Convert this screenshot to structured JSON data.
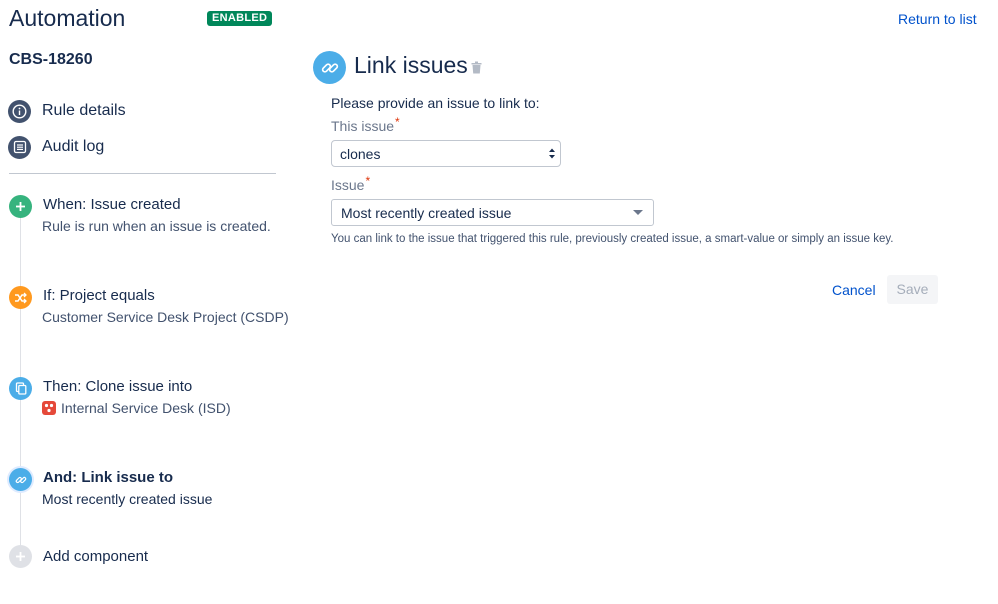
{
  "header": {
    "title": "Automation",
    "status_badge": "ENABLED",
    "return_link": "Return to list"
  },
  "rule": {
    "id": "CBS-18260"
  },
  "nav": {
    "rule_details": "Rule details",
    "audit_log": "Audit log"
  },
  "steps": [
    {
      "title": "When: Issue created",
      "description": "Rule is run when an issue is created.",
      "icon": "plus-icon",
      "color": "#36b37e"
    },
    {
      "title": "If: Project equals",
      "description": "Customer Service Desk Project (CSDP)",
      "icon": "shuffle-icon",
      "color": "#ff991f"
    },
    {
      "title": "Then: Clone issue into",
      "description": "Internal Service Desk (ISD)",
      "icon": "copy-icon",
      "color": "#4bade8"
    },
    {
      "title": "And: Link issue to",
      "description": "Most recently created issue",
      "icon": "link-icon",
      "color": "#4bade8"
    }
  ],
  "add_component": "Add component",
  "panel": {
    "title": "Link issues",
    "instruction": "Please provide an issue to link to:",
    "this_issue_label": "This issue",
    "this_issue_value": "clones",
    "issue_label": "Issue",
    "issue_value": "Most recently created issue",
    "help_text": "You can link to the issue that triggered this rule, previously created issue, a smart-value or simply an issue key.",
    "required_marker": "*"
  },
  "actions": {
    "cancel": "Cancel",
    "save": "Save"
  }
}
